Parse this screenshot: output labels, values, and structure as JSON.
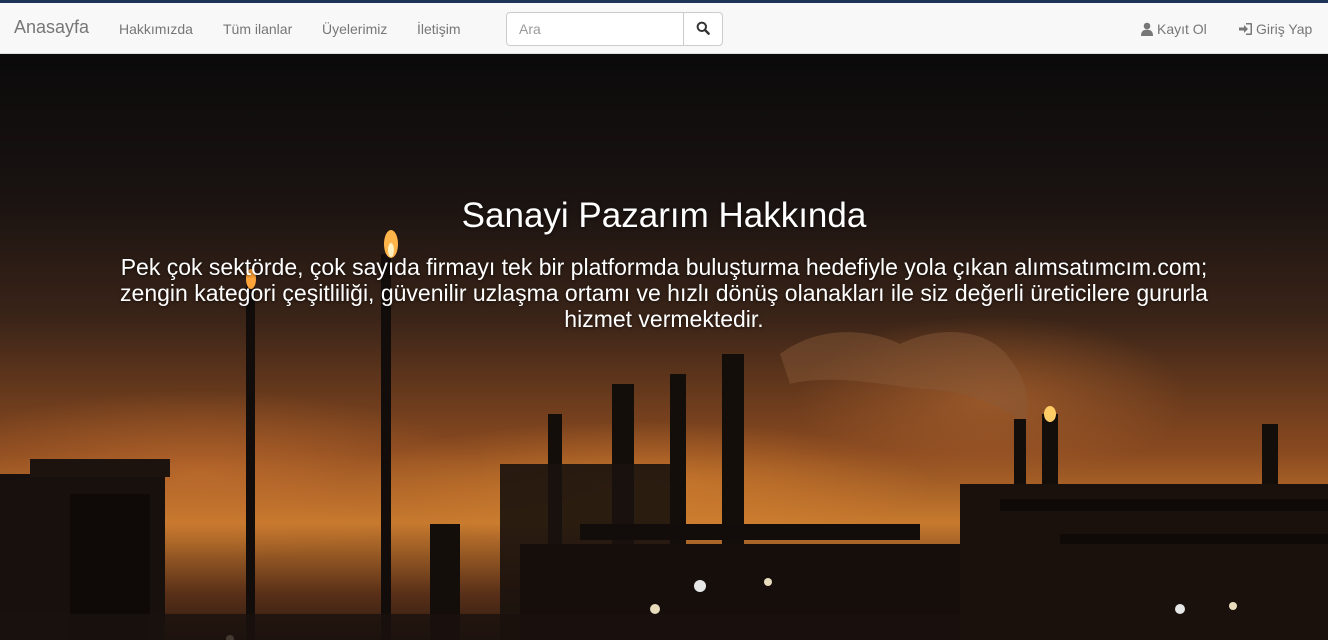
{
  "navbar": {
    "brand": "Anasayfa",
    "links": [
      "Hakkımızda",
      "Tüm ilanlar",
      "Üyelerimiz",
      "İletişim"
    ],
    "search_placeholder": "Ara",
    "register_label": "Kayıt Ol",
    "login_label": "Giriş Yap"
  },
  "icons": {
    "search": "search-icon",
    "register": "user-icon",
    "login": "login-icon"
  },
  "hero": {
    "title": "Sanayi Pazarım Hakkında",
    "description": "Pek çok sektörde, çok sayıda firmayı tek bir platformda buluşturma hedefiyle yola çıkan alımsatımcım.com; zengin kategori çeşitliliği, güvenilir uzlaşma ortamı ve hızlı dönüş olanakları ile siz değerli üreticilere gururla hizmet vermektedir."
  },
  "colors": {
    "topline": "#1e3457",
    "navbar_bg": "#f8f8f8",
    "nav_text": "#777777"
  }
}
